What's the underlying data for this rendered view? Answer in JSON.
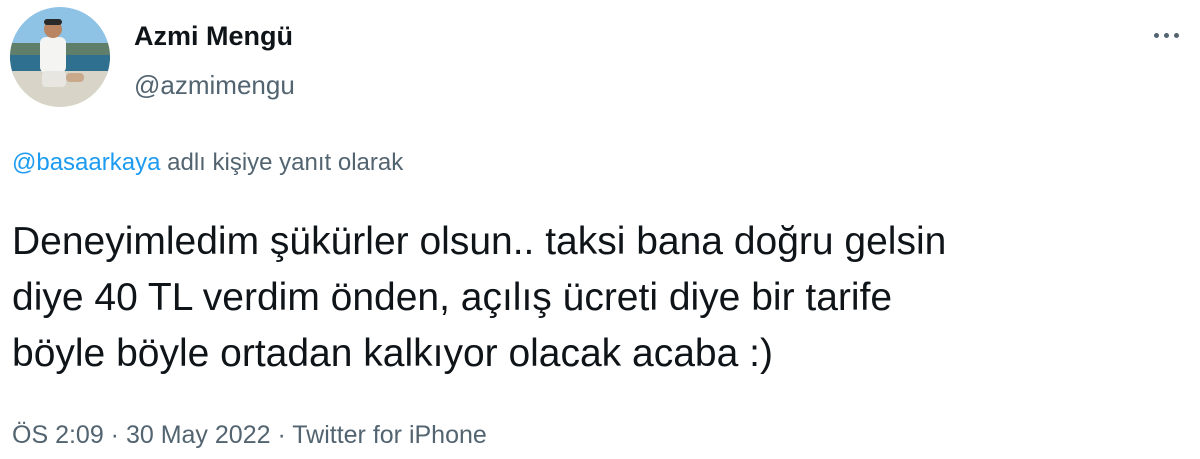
{
  "author": {
    "display_name": "Azmi Mengü",
    "handle": "@azmimengu",
    "avatar_icon": "profile-photo"
  },
  "more_icon": "more-horizontal-icon",
  "reply_context": {
    "mention": "@basaarkaya",
    "suffix": " adlı kişiye yanıt olarak"
  },
  "tweet": {
    "lines": [
      "Deneyimledim şükürler olsun.. taksi bana doğru gelsin",
      "diye 40 TL verdim önden, açılış ücreti diye bir tarife",
      "böyle böyle ortadan kalkıyor olacak acaba :)"
    ]
  },
  "meta": {
    "time": "ÖS 2:09",
    "separator": " · ",
    "date": "30 May 2022",
    "source": "Twitter for iPhone"
  },
  "colors": {
    "text": "#0f1419",
    "secondary": "#536471",
    "link": "#1d9bf0"
  }
}
